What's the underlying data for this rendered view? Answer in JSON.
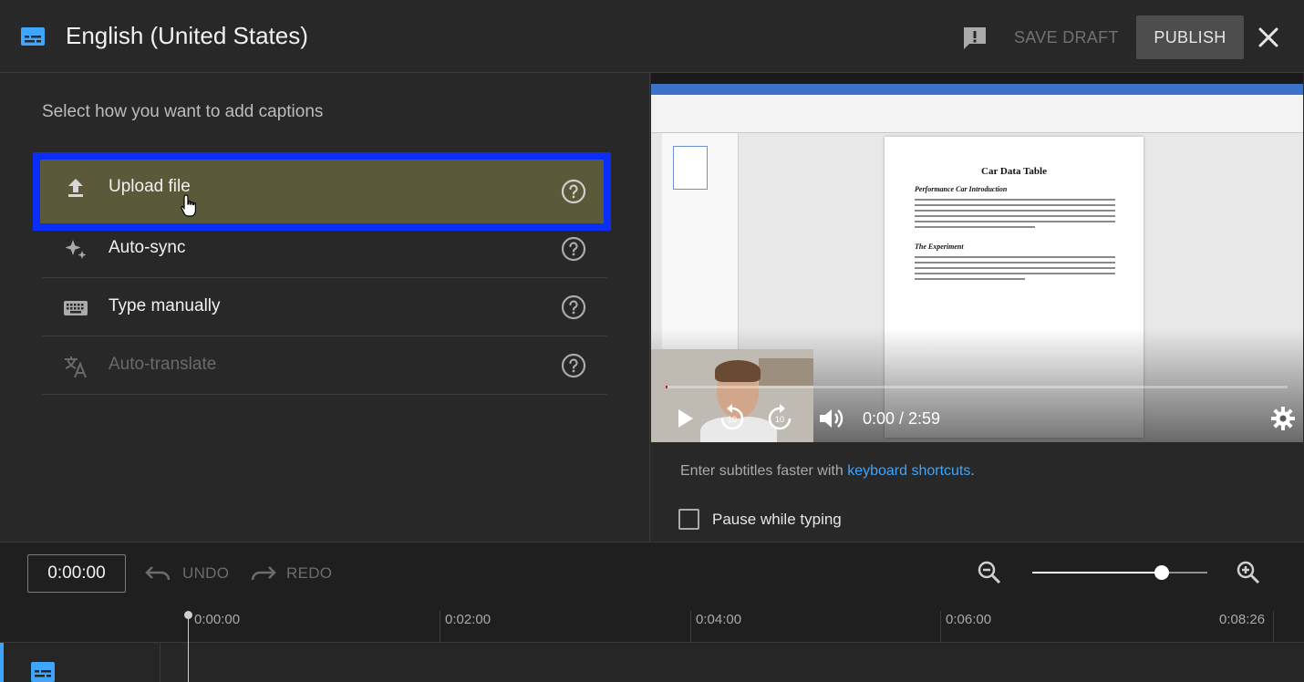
{
  "header": {
    "title": "English (United States)",
    "save_draft": "SAVE DRAFT",
    "publish": "PUBLISH",
    "subtitles_icon": "subtitles-icon",
    "feedback_icon": "feedback-icon",
    "close_icon": "close-icon"
  },
  "captions": {
    "prompt": "Select how you want to add captions",
    "options": [
      {
        "label": "Upload file",
        "icon": "upload-icon",
        "selected": true
      },
      {
        "label": "Auto-sync",
        "icon": "sparkle-icon"
      },
      {
        "label": "Type manually",
        "icon": "keyboard-icon"
      },
      {
        "label": "Auto-translate",
        "icon": "translate-icon",
        "disabled": true
      }
    ]
  },
  "video": {
    "doc_title": "Car Data Table",
    "doc_heading_1": "Performance Car Introduction",
    "doc_heading_2": "The Experiment",
    "time": "0:00 / 2:59",
    "progress": 0.0
  },
  "hint": {
    "text": "Enter subtitles faster with ",
    "link": "keyboard shortcuts",
    "end": "."
  },
  "pause_while_typing": {
    "label": "Pause while typing",
    "checked": false
  },
  "toolbar": {
    "timecode": "0:00:00",
    "undo": "UNDO",
    "redo": "REDO",
    "zoom_level": 0.74
  },
  "timeline": {
    "ticks": [
      "0:00:00",
      "0:02:00",
      "0:04:00",
      "0:06:00",
      "0:08:26"
    ]
  },
  "colors": {
    "accent_blue": "#3ea6ff",
    "selection_border": "#0a2ef8",
    "selected_bg": "#5a5939"
  }
}
